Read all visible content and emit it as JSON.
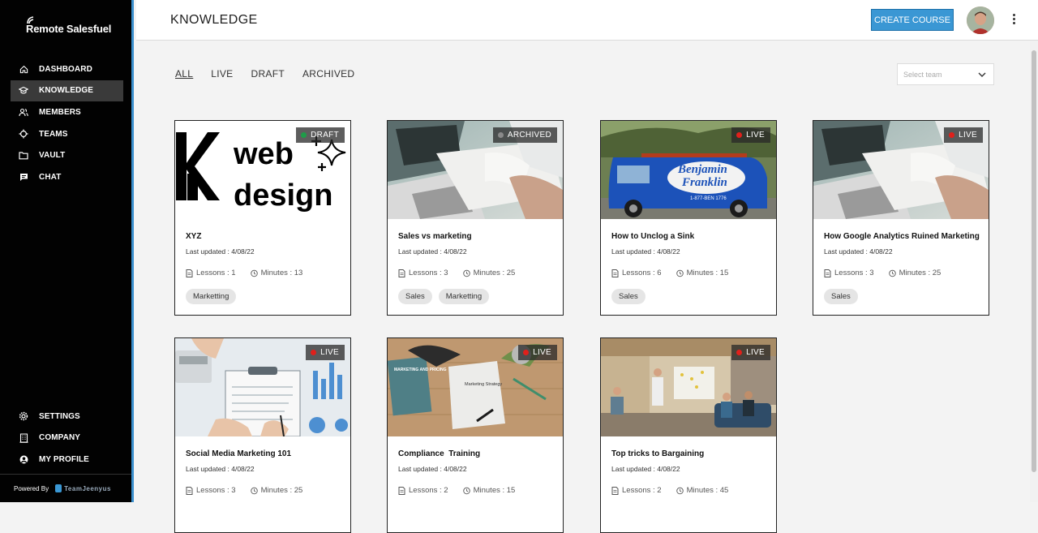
{
  "brand": {
    "name": "Remote Salesfuel"
  },
  "sidebar": {
    "items": [
      {
        "label": "DASHBOARD",
        "icon": "home-icon"
      },
      {
        "label": "KNOWLEDGE",
        "icon": "graduation-cap-icon",
        "active": true
      },
      {
        "label": "MEMBERS",
        "icon": "members-icon"
      },
      {
        "label": "TEAMS",
        "icon": "teams-icon"
      },
      {
        "label": "VAULT",
        "icon": "folder-icon"
      },
      {
        "label": "CHAT",
        "icon": "chat-icon"
      }
    ],
    "bottom_items": [
      {
        "label": "SETTINGS",
        "icon": "gear-icon"
      },
      {
        "label": "COMPANY",
        "icon": "building-icon"
      },
      {
        "label": "MY PROFILE",
        "icon": "user-icon"
      }
    ],
    "powered_by": "Powered By",
    "powered_brand": "TeamJeenyus"
  },
  "header": {
    "title": "KNOWLEDGE",
    "create_button": "CREATE COURSE"
  },
  "filters": {
    "tabs": [
      "ALL",
      "LIVE",
      "DRAFT",
      "ARCHIVED"
    ],
    "active_tab": "ALL",
    "team_select_placeholder": "Select team"
  },
  "colors": {
    "accent": "#3a97d4",
    "live": "#e0201b",
    "draft": "#1f9b49",
    "archived": "#8a8a8a"
  },
  "courses": [
    {
      "title": "XYZ",
      "updated": "Last updated : 4/08/22",
      "lessons": "Lessons : 1",
      "minutes": "Minutes : 13",
      "status": "DRAFT",
      "tags": [
        "Marketting"
      ]
    },
    {
      "title": "Sales vs marketing",
      "updated": "Last updated : 4/08/22",
      "lessons": "Lessons : 3",
      "minutes": "Minutes : 25",
      "status": "ARCHIVED",
      "tags": [
        "Sales",
        "Marketting"
      ]
    },
    {
      "title": "How to Unclog a Sink",
      "updated": "Last updated : 4/08/22",
      "lessons": "Lessons : 6",
      "minutes": "Minutes : 15",
      "status": "LIVE",
      "tags": [
        "Sales"
      ]
    },
    {
      "title": "How Google Analytics Ruined Marketing",
      "updated": "Last updated : 4/08/22",
      "lessons": "Lessons : 3",
      "minutes": "Minutes : 25",
      "status": "LIVE",
      "tags": [
        "Sales"
      ]
    },
    {
      "title": "Social Media Marketing 101",
      "updated": "Last updated : 4/08/22",
      "lessons": "Lessons : 3",
      "minutes": "Minutes : 25",
      "status": "LIVE",
      "tags": []
    },
    {
      "title": "Compliance  Training",
      "updated": "Last updated : 4/08/22",
      "lessons": "Lessons : 2",
      "minutes": "Minutes : 15",
      "status": "LIVE",
      "tags": []
    },
    {
      "title": "Top tricks to Bargaining",
      "updated": "Last updated : 4/08/22",
      "lessons": "Lessons : 2",
      "minutes": "Minutes : 45",
      "status": "LIVE",
      "tags": []
    }
  ],
  "thumbnails": {
    "web_design_text_1": "web",
    "web_design_text_2": "design",
    "van_text_1": "Benjamin",
    "van_text_2": "Franklin",
    "van_phone": "1-877-BEN 1776",
    "note_text": "Marketing Strategy",
    "book_text": "MARKETING AND PRICING"
  }
}
